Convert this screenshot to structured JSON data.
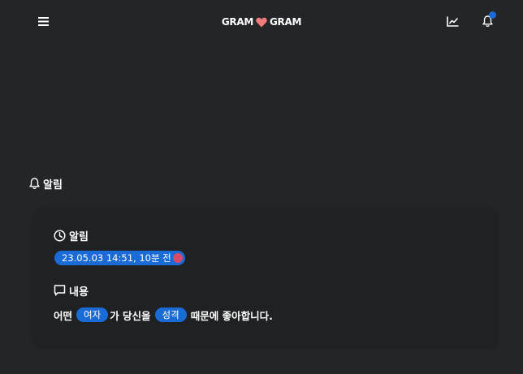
{
  "header": {
    "brand_left": "GRAM",
    "brand_right": "GRAM",
    "icons": [
      "menu-icon",
      "heart-icon",
      "chart-icon",
      "bell-icon"
    ],
    "notification_dot": true
  },
  "colors": {
    "background": "#242527",
    "card": "#202123",
    "accent": "#1a6bd6",
    "heart": "#f07b7b",
    "indicator": "#d74a6a"
  },
  "section": {
    "title": "알림"
  },
  "card": {
    "time_label": "알림",
    "time_value": "23.05.03 14:51, 10분 전",
    "content_label": "내용",
    "content": {
      "part1": "어떤",
      "tag1": "여자",
      "part2": "가 당신을",
      "tag2": "성격",
      "part3": "때문에 좋아합니다."
    }
  }
}
